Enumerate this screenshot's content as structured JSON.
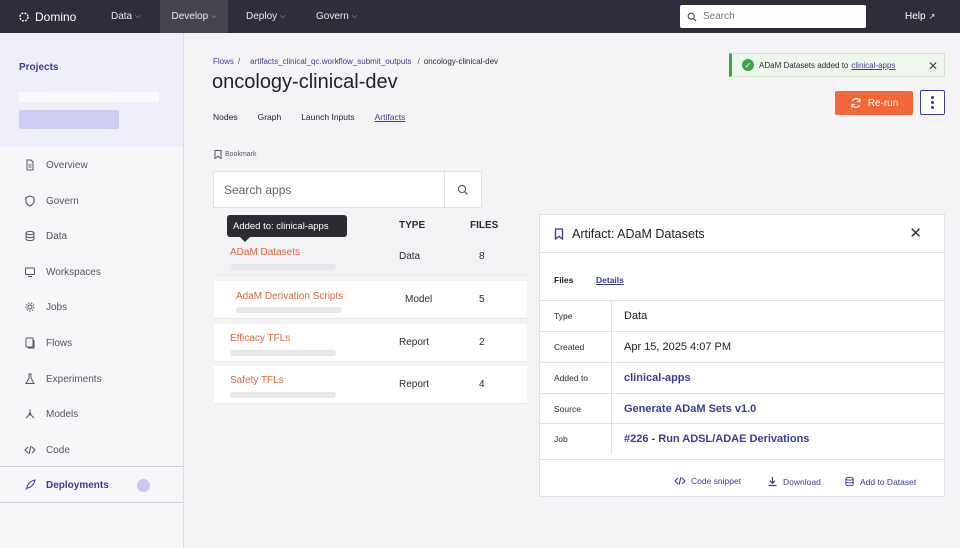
{
  "topbar": {
    "brand": "Domino",
    "nav": [
      {
        "label": "Data"
      },
      {
        "label": "Develop"
      },
      {
        "label": "Deploy"
      },
      {
        "label": "Govern"
      }
    ],
    "search_placeholder": "Search",
    "help": "Help"
  },
  "sidebar": {
    "projects_title": "Projects",
    "items": [
      {
        "label": "Overview",
        "icon": "document-icon"
      },
      {
        "label": "Govern",
        "icon": "shield-icon"
      },
      {
        "label": "Data",
        "icon": "database-icon"
      },
      {
        "label": "Workspaces",
        "icon": "monitor-icon"
      },
      {
        "label": "Jobs",
        "icon": "gear-icon"
      },
      {
        "label": "Flows",
        "icon": "flows-icon"
      },
      {
        "label": "Experiments",
        "icon": "flask-icon"
      },
      {
        "label": "Models",
        "icon": "models-icon"
      },
      {
        "label": "Code",
        "icon": "code-icon"
      }
    ],
    "deployments": "Deployments"
  },
  "breadcrumb": {
    "items": [
      "Flows",
      "artifacts_clinical_qc.workflow_submit_outputs"
    ],
    "current": "oncology-clinical-dev",
    "separator": "/"
  },
  "page": {
    "title": "oncology-clinical-dev",
    "tabs": [
      "Nodes",
      "Graph",
      "Launch Inputs",
      "Artifacts"
    ],
    "active_tab": "Artifacts",
    "bookmark": "Bookmark",
    "rerun": "Re-run"
  },
  "toast": {
    "text": "ADaM Datasets added to",
    "link": "clinical-apps",
    "color": "#3aa645"
  },
  "apps": {
    "search_placeholder": "Search apps",
    "columns": {
      "type": "TYPE",
      "files": "FILES"
    },
    "tooltip": "Added to: clinical-apps",
    "rows": [
      {
        "name": "ADaM Datasets",
        "type": "Data",
        "files": "8"
      },
      {
        "name": "AdaM Derivation Scripts",
        "type": "Model",
        "files": "5"
      },
      {
        "name": "Efficacy TFLs",
        "type": "Report",
        "files": "2"
      },
      {
        "name": "Safety TFLs",
        "type": "Report",
        "files": "4"
      }
    ]
  },
  "artifact": {
    "title": "Artifact: ADaM Datasets",
    "tabs": {
      "files": "Files",
      "details": "Details"
    },
    "rows": [
      {
        "key": "Type",
        "value": "Data"
      },
      {
        "key": "Created",
        "value": "Apr 15, 2025 4:07 PM"
      },
      {
        "key": "Added to",
        "value": "clinical-apps"
      },
      {
        "key": "Source",
        "value": "Generate ADaM Sets v1.0"
      },
      {
        "key": "Job",
        "value": "#226 - Run ADSL/ADAE Derivations"
      }
    ],
    "actions": {
      "code": "Code snippet",
      "download": "Download",
      "add": "Add to Dataset"
    }
  },
  "colors": {
    "accent": "#3c3c9a",
    "orange": "#f2663a",
    "topbar": "#2e2e3a"
  }
}
